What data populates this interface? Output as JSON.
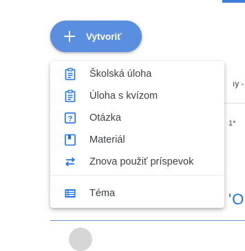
{
  "create_button": {
    "label": "Vytvoriť",
    "icon": "plus-icon"
  },
  "menu": {
    "items": [
      {
        "label": "Školská úloha",
        "icon": "assignment-icon"
      },
      {
        "label": "Úloha s kvízom",
        "icon": "quiz-assignment-icon"
      },
      {
        "label": "Otázka",
        "icon": "question-icon"
      },
      {
        "label": "Materiál",
        "icon": "material-icon"
      },
      {
        "label": "Znova použiť príspevok",
        "icon": "reuse-post-icon"
      },
      {
        "label": "Téma",
        "icon": "topic-icon"
      }
    ]
  },
  "background": {
    "text_fragment_1": "ıy - v",
    "text_fragment_2": "1*",
    "text_fragment_3": "'O"
  },
  "colors": {
    "accent": "#3b7ddb",
    "create_button": "#5a8fe0",
    "icon": "#1a73e8",
    "menu_text": "#3c4043"
  }
}
